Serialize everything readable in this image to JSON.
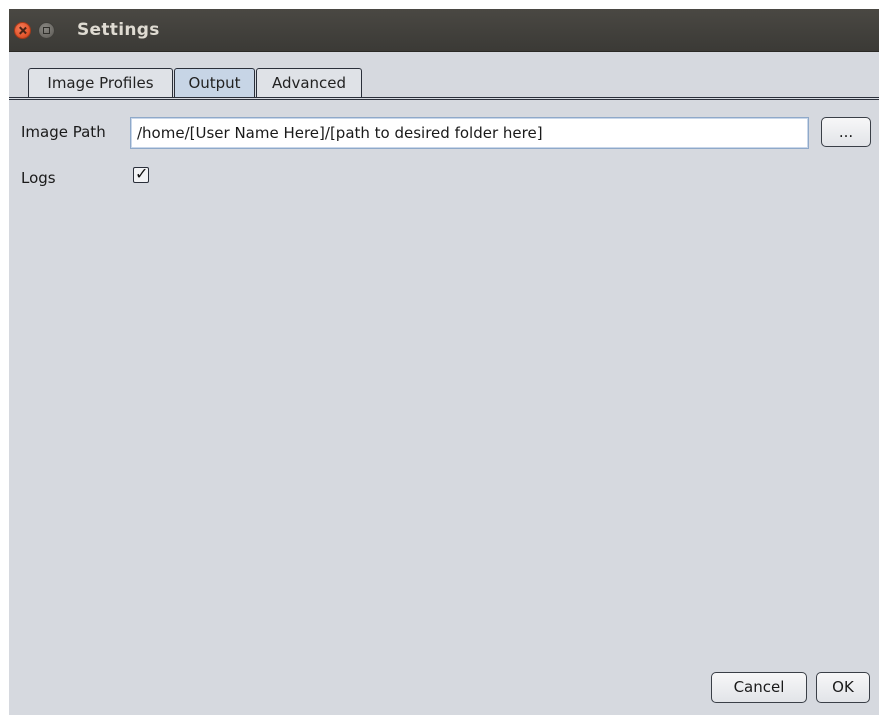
{
  "window": {
    "title": "Settings",
    "close_icon": "close-icon",
    "maximize_icon": "maximize-icon"
  },
  "tabs": [
    {
      "label": "Image Profiles",
      "active": false
    },
    {
      "label": "Output",
      "active": true
    },
    {
      "label": "Advanced",
      "active": false
    }
  ],
  "output": {
    "image_path_label": "Image Path",
    "image_path_value": "/home/[User Name Here]/[path to desired folder here]",
    "browse_label": "...",
    "logs_label": "Logs",
    "logs_checked": true,
    "checkmark_glyph": "✓"
  },
  "footer": {
    "cancel_label": "Cancel",
    "ok_label": "OK"
  },
  "colors": {
    "titlebar": "#3b3a36",
    "content_bg": "#d6d9df",
    "active_tab": "#c7d5e6"
  }
}
